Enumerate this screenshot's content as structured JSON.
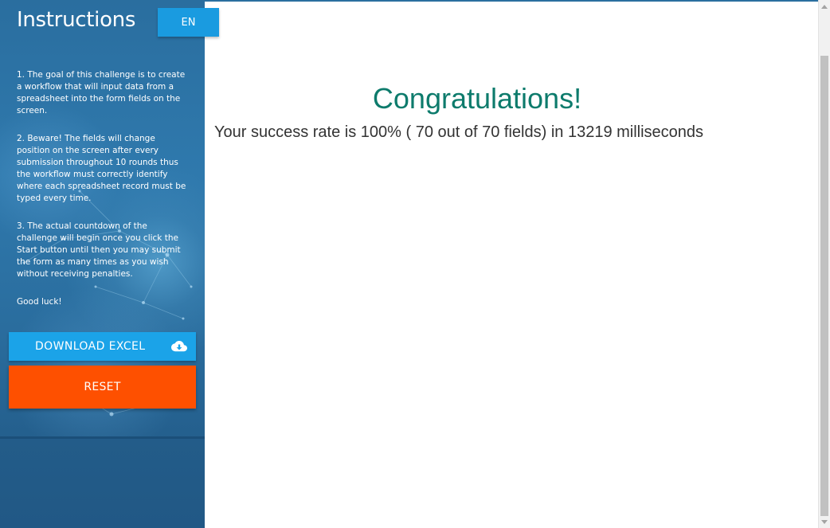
{
  "sidebar": {
    "title": "Instructions",
    "language_button": "EN",
    "instructions": [
      "1. The goal of this challenge is to create a workflow that will input data from a spreadsheet into the form fields on the screen.",
      "2. Beware! The fields will change position on the screen after every submission throughout 10 rounds thus the workflow must correctly identify where each spreadsheet record must be typed every time.",
      "3. The actual countdown of the challenge will begin once you click the Start button until then you may submit the form as many times as you wish without receiving penalties.",
      "Good luck!"
    ],
    "download_button": "DOWNLOAD EXCEL",
    "download_icon": "cloud-download-icon",
    "reset_button": "RESET"
  },
  "main": {
    "heading": "Congratulations!",
    "result_text": "Your success rate is 100% ( 70 out of 70 fields) in 13219 milliseconds"
  },
  "colors": {
    "sidebar": "#2a6e9f",
    "language_button": "#1a9be0",
    "download_button": "#1ba3e8",
    "reset_button": "#fe5000",
    "heading": "#0d7b6c"
  }
}
